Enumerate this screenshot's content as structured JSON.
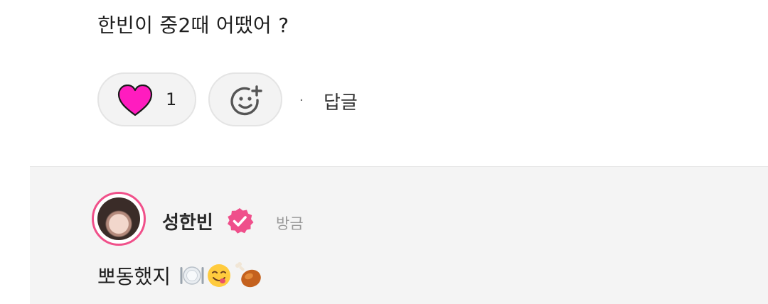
{
  "comment": {
    "text": "한빈이 중2때 어땠어 ?",
    "like_count": "1",
    "dot": "·",
    "reply_label": "답글",
    "icons": {
      "like": "heart-icon",
      "react": "add-reaction-icon"
    },
    "colors": {
      "heart": "#ff1cbf",
      "pill_bg": "#f3f3f3"
    }
  },
  "reply": {
    "author": "성한빈",
    "timestamp": "방금",
    "text": "뽀동했지",
    "emojis": [
      "plate-with-cutlery-icon",
      "yum-face-icon",
      "poultry-leg-icon"
    ],
    "colors": {
      "verified": "#ef4f8b",
      "avatar_ring": "#f0508a",
      "section_bg": "#f4f4f4"
    }
  }
}
